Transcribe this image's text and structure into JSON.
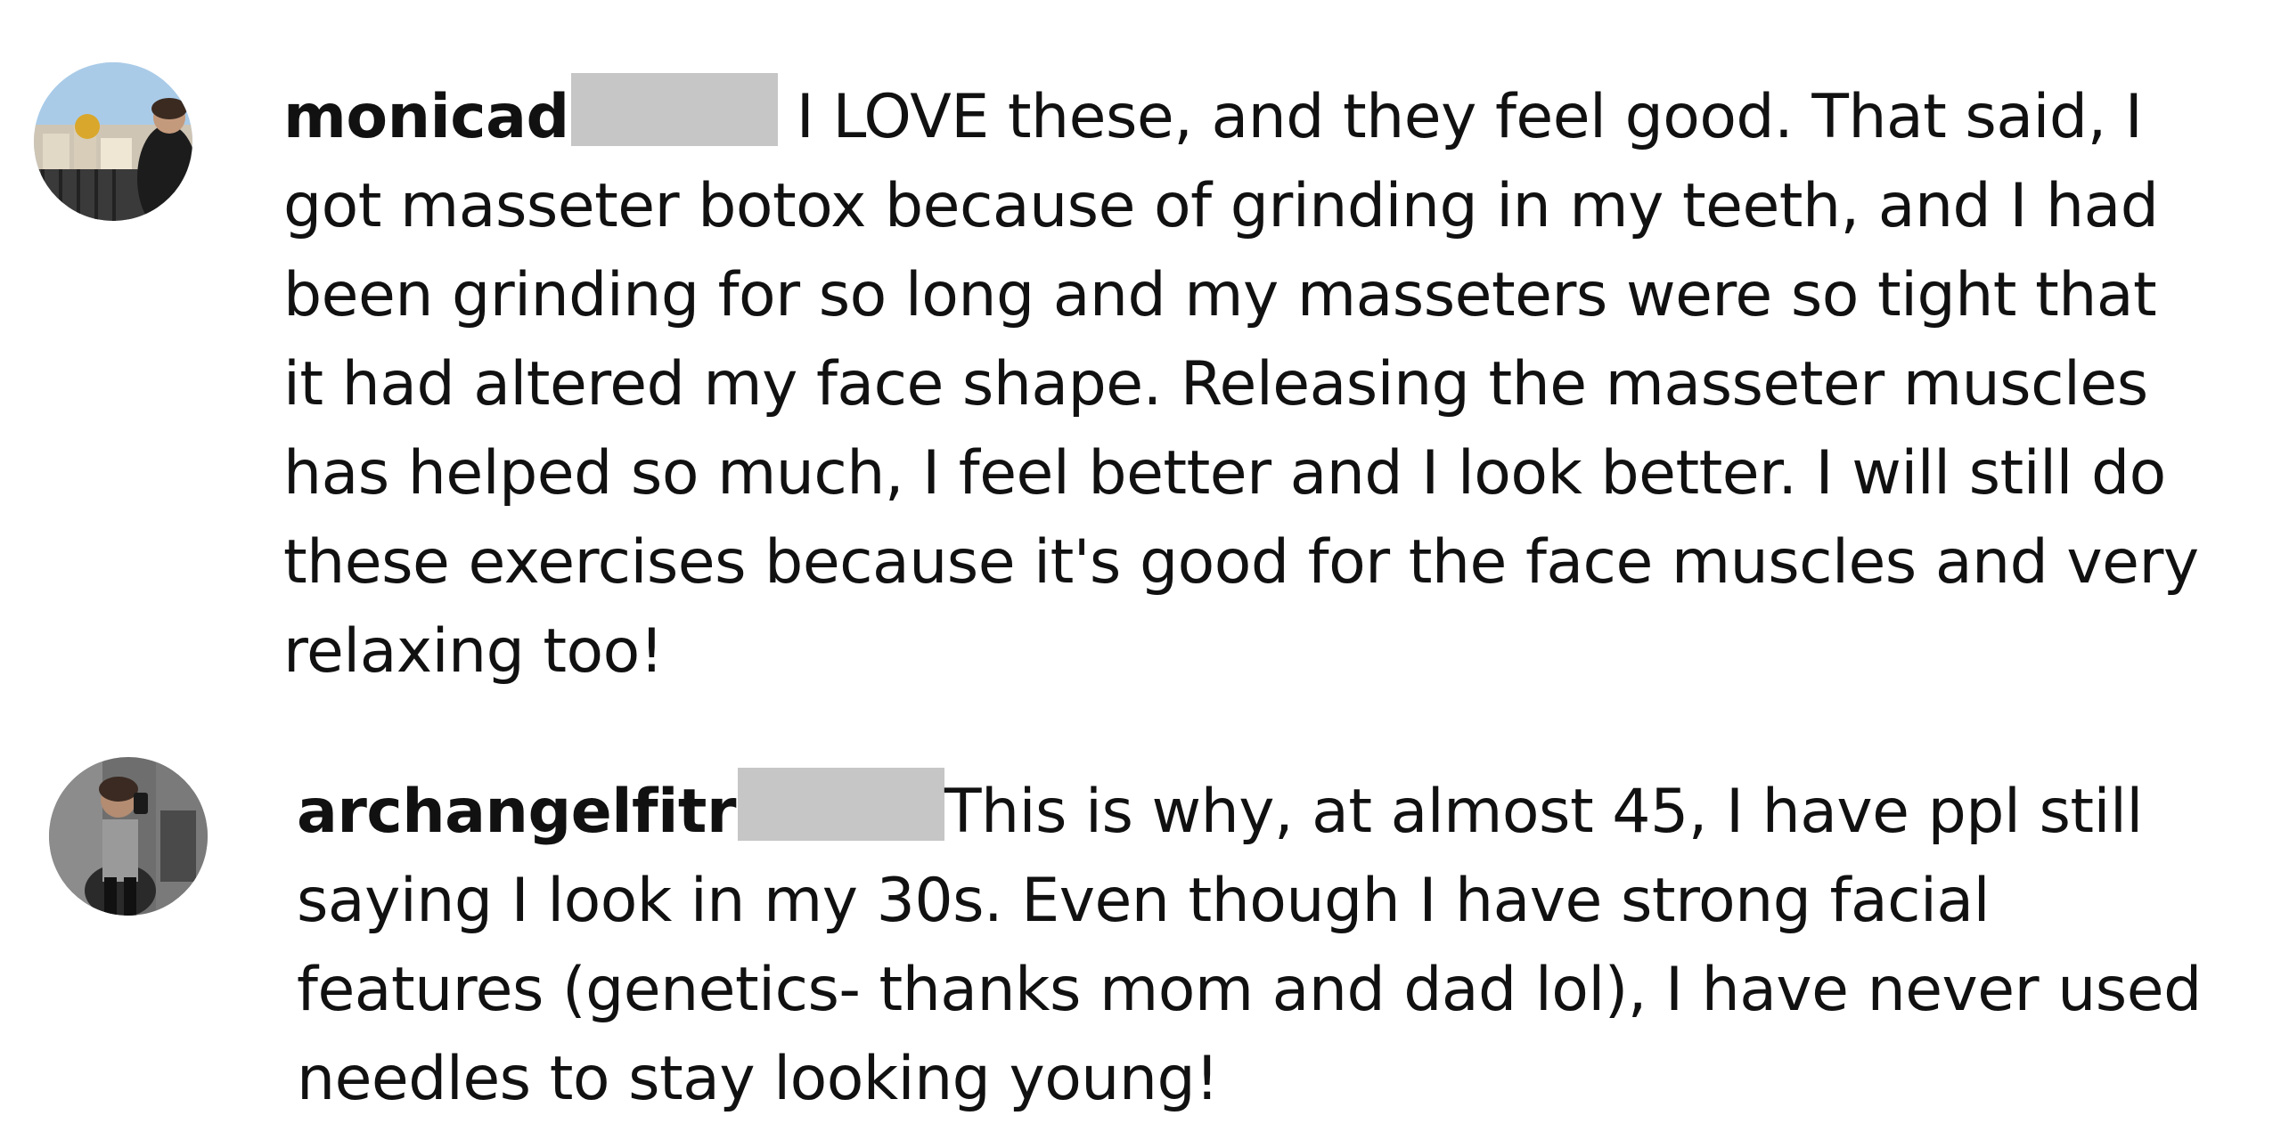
{
  "comments": [
    {
      "username": "monicad",
      "avatar_icon": "avatar-photo-icon",
      "lines": [
        "I LOVE these, and they feel good. That said, I",
        "got masseter botox because of grinding in my teeth, and I had",
        "been grinding for so long and my masseters were so tight that",
        "it had altered my face shape. Releasing the masseter muscles",
        "has helped so much, I feel better and I look better. I will still do",
        "these exercises because it's good for the face muscles and very",
        "relaxing too!"
      ]
    },
    {
      "username": "archangelfitr",
      "avatar_icon": "avatar-photo-icon",
      "lines": [
        "This is why, at almost 45, I have ppl still",
        "saying I look in my 30s. Even though I have strong facial",
        "features (genetics- thanks mom and dad lol), I have never used",
        "needles to stay looking young!"
      ]
    }
  ],
  "colors": {
    "text": "#111111",
    "redaction": "#c6c6c6",
    "background": "#ffffff"
  }
}
